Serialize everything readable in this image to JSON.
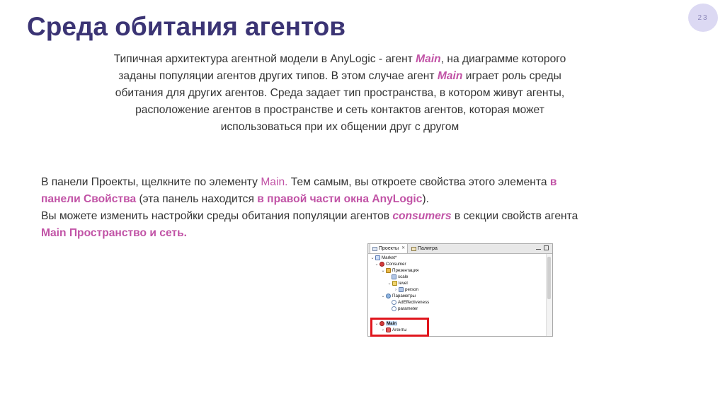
{
  "slide": {
    "page_number": "23",
    "title": "Среда обитания агентов"
  },
  "intro": {
    "part1": "Типичная архитектура агентной модели в AnyLogic - агент ",
    "main1": "Main",
    "part2": ", на диаграмме которого заданы популяции агентов других типов. В этом случае агент ",
    "main2": "Main",
    "part3": " играет роль среды обитания для других агентов. Среда задает тип пространства, в котором живут агенты, расположение агентов в пространстве и сеть контактов агентов, которая может использоваться при их общении друг с другом"
  },
  "body": {
    "t1": "В панели Проекты, щелкните по элементу ",
    "main": "Main.",
    "t2": " Тем самым, вы откроете свойства этого элемента ",
    "props_panel": "в панели Свойства",
    "t3": " (эта панель находится ",
    "right_part": "в правой части окна AnyLogic",
    "t4": ").",
    "t5": "Вы можете изменить настройки среды обитания популяции агентов ",
    "consumers": "consumers",
    "t6": " в секции свойств агента ",
    "main_space": "Main Пространство и сеть."
  },
  "panel": {
    "tabs": [
      {
        "label": "Проекты",
        "close": "✕"
      },
      {
        "label": "Палитра"
      }
    ],
    "tree": [
      {
        "label": "Market*",
        "icon": "model-icon"
      },
      {
        "label": "Consumer",
        "icon": "agent-type-icon"
      },
      {
        "label": "Презентация",
        "icon": "presentation-icon"
      },
      {
        "label": "scale",
        "icon": "scale-icon"
      },
      {
        "label": "level",
        "icon": "level-icon"
      },
      {
        "label": "person",
        "icon": "shape-icon"
      },
      {
        "label": "Параметры",
        "icon": "parameters-icon"
      },
      {
        "label": "AdEffectiveness",
        "icon": "parameter-icon"
      },
      {
        "label": "parameter",
        "icon": "parameter-icon"
      },
      {
        "label": "Main",
        "icon": "agent-type-icon"
      },
      {
        "label": "Агенты",
        "icon": "agent-population-icon"
      }
    ]
  },
  "colors": {
    "title": "#3b3474",
    "accent": "#c153a6",
    "highlight_box": "#e0161d"
  }
}
